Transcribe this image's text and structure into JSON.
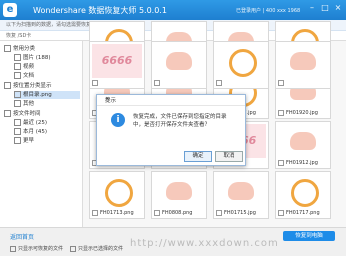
{
  "window": {
    "title": "Wondershare 数据恢复大师 5.0.0.1",
    "user_info": "已登录用户 | 400 xxx 1968",
    "min": "–",
    "max": "□",
    "close": "×"
  },
  "subtitle": "以下为扫描到的数据，请勾选需要恢复的文件",
  "path": {
    "label": "恢复 /SD卡"
  },
  "sidebar": {
    "items": [
      {
        "label": "常用分类"
      },
      {
        "label": "图片 (188)"
      },
      {
        "label": "视频"
      },
      {
        "label": "文档"
      },
      {
        "label": "按位置分类显示"
      },
      {
        "label": "根目录.png"
      },
      {
        "label": "其他"
      },
      {
        "label": "按文件时间"
      },
      {
        "label": "最近 (25)"
      },
      {
        "label": "本月 (45)"
      },
      {
        "label": "更早"
      }
    ]
  },
  "thumbs": [
    {
      "name": "",
      "art": ""
    },
    {
      "name": "",
      "art": ""
    },
    {
      "name": "",
      "art": ""
    },
    {
      "name": "",
      "art": ""
    },
    {
      "name": "FH01906.jpg",
      "art": ""
    },
    {
      "name": "FH01908.jpg",
      "art": ""
    },
    {
      "name": "FH01917.jpg",
      "art": ""
    },
    {
      "name": "FH01920.jpg",
      "art": ""
    },
    {
      "name": "",
      "art": ""
    },
    {
      "name": "",
      "art": ""
    },
    {
      "name": "",
      "art": "6666"
    },
    {
      "name": "FH01912.jpg",
      "art": ""
    },
    {
      "name": "FH01713.png",
      "art": ""
    },
    {
      "name": "FH0808.png",
      "art": ""
    },
    {
      "name": "FH01715.jpg",
      "art": ""
    },
    {
      "name": "FH01717.png",
      "art": ""
    },
    {
      "name": "",
      "art": "6666"
    },
    {
      "name": "",
      "art": ""
    },
    {
      "name": "",
      "art": ""
    },
    {
      "name": "",
      "art": ""
    }
  ],
  "dialog": {
    "title": "提示",
    "message": "恢复完成，文件已保存到您指定的目录中，是否打开保存文件夹查看？",
    "ok": "确定",
    "cancel": "取消"
  },
  "bottom": {
    "back": "返回首页",
    "recover": "恢复到电脑",
    "check1": "只显示可恢复的文件",
    "check2": "只显示已选择的文件"
  },
  "watermark": "http://www.xxxdown.com"
}
